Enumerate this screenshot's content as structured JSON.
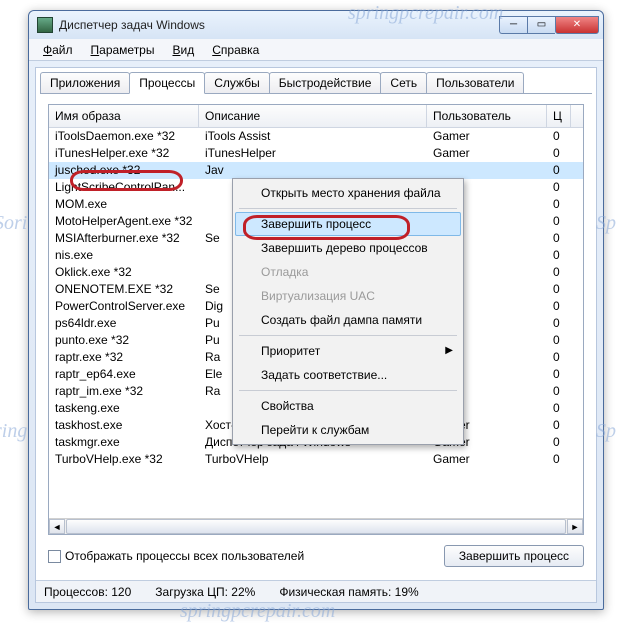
{
  "window": {
    "title": "Диспетчер задач Windows"
  },
  "menubar": [
    "Файл",
    "Параметры",
    "Вид",
    "Справка"
  ],
  "tabs": {
    "items": [
      "Приложения",
      "Процессы",
      "Службы",
      "Быстродействие",
      "Сеть",
      "Пользователи"
    ],
    "active_index": 1
  },
  "columns": {
    "image_name": "Имя образа",
    "description": "Описание",
    "user": "Пользователь",
    "extra": "Ц"
  },
  "processes": [
    {
      "name": "iToolsDaemon.exe *32",
      "desc": "iTools Assist",
      "user": "Gamer",
      "x": "0"
    },
    {
      "name": "iTunesHelper.exe *32",
      "desc": "iTunesHelper",
      "user": "Gamer",
      "x": "0"
    },
    {
      "name": "jusched.exe *32",
      "desc": "Jav",
      "user": "",
      "x": "0",
      "selected": true
    },
    {
      "name": "LightScribeControlPan...",
      "desc": "",
      "user": "",
      "x": "0"
    },
    {
      "name": "MOM.exe",
      "desc": "",
      "user": "",
      "x": "0"
    },
    {
      "name": "MotoHelperAgent.exe *32",
      "desc": "",
      "user": "",
      "x": "0"
    },
    {
      "name": "MSIAfterburner.exe *32",
      "desc": "Se",
      "user": "",
      "x": "0"
    },
    {
      "name": "nis.exe",
      "desc": "",
      "user": "",
      "x": "0"
    },
    {
      "name": "Oklick.exe *32",
      "desc": "",
      "user": "",
      "x": "0"
    },
    {
      "name": "ONENOTEM.EXE *32",
      "desc": "Se",
      "user": "",
      "x": "0"
    },
    {
      "name": "PowerControlServer.exe",
      "desc": "Dig",
      "user": "",
      "x": "0"
    },
    {
      "name": "ps64ldr.exe",
      "desc": "Pu",
      "user": "",
      "x": "0"
    },
    {
      "name": "punto.exe *32",
      "desc": "Pu",
      "user": "",
      "x": "0"
    },
    {
      "name": "raptr.exe *32",
      "desc": "Ra",
      "user": "",
      "x": "0"
    },
    {
      "name": "raptr_ep64.exe",
      "desc": "Ele",
      "user": "",
      "x": "0"
    },
    {
      "name": "raptr_im.exe *32",
      "desc": "Ra",
      "user": "",
      "x": "0"
    },
    {
      "name": "taskeng.exe",
      "desc": "",
      "user": "",
      "x": "0"
    },
    {
      "name": "taskhost.exe",
      "desc": "Хост-процесс для задач Win...",
      "user": "Gamer",
      "x": "0"
    },
    {
      "name": "taskmgr.exe",
      "desc": "Диспетчер задач Windows",
      "user": "Gamer",
      "x": "0"
    },
    {
      "name": "TurboVHelp.exe *32",
      "desc": "TurboVHelp",
      "user": "Gamer",
      "x": "0"
    }
  ],
  "context_menu": {
    "items": [
      {
        "label": "Открыть место хранения файла"
      },
      {
        "sep": true
      },
      {
        "label": "Завершить процесс",
        "hover": true
      },
      {
        "label": "Завершить дерево процессов"
      },
      {
        "label": "Отладка",
        "disabled": true
      },
      {
        "label": "Виртуализация UAC",
        "disabled": true
      },
      {
        "label": "Создать файл дампа памяти"
      },
      {
        "sep": true
      },
      {
        "label": "Приоритет",
        "submenu": true
      },
      {
        "label": "Задать соответствие..."
      },
      {
        "sep": true
      },
      {
        "label": "Свойства"
      },
      {
        "label": "Перейти к службам"
      }
    ]
  },
  "checkbox_label": "Отображать процессы всех пользователей",
  "end_process_button": "Завершить процесс",
  "status": {
    "processes": "Процессов: 120",
    "cpu": "Загрузка ЦП: 22%",
    "mem": "Физическая память: 19%"
  },
  "watermark": "springpcrepair.com"
}
